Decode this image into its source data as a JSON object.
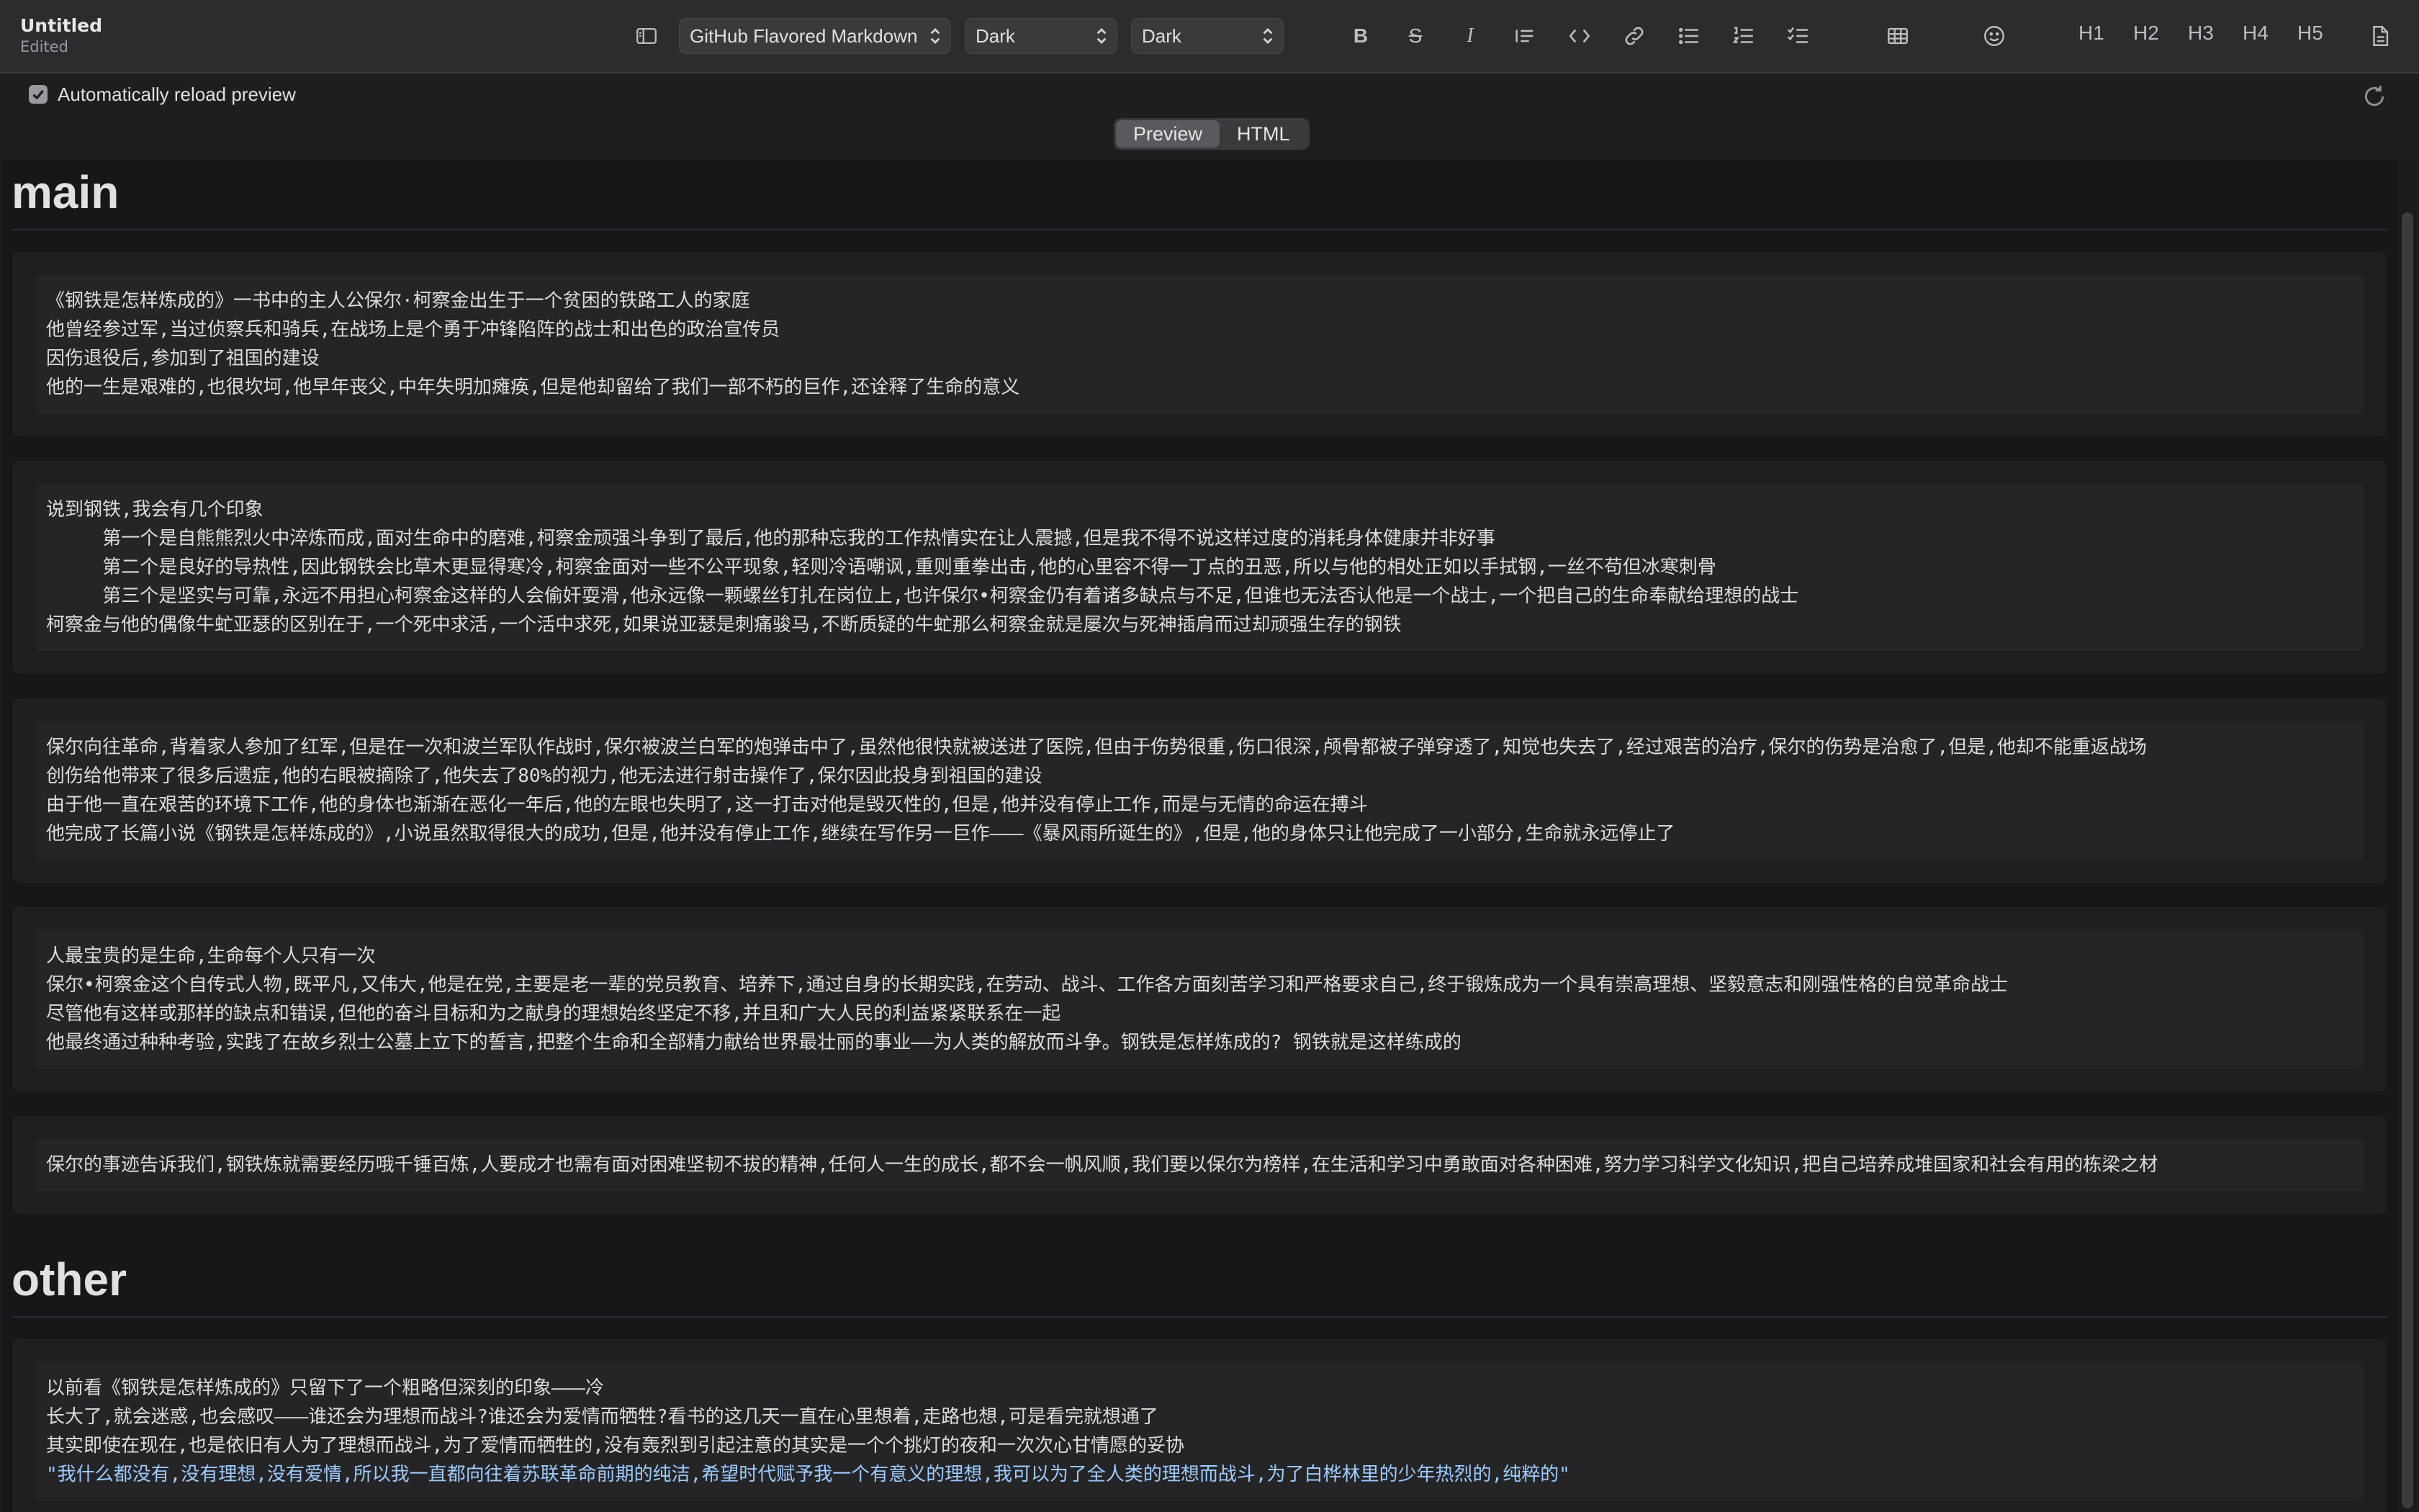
{
  "window": {
    "title": "Untitled",
    "subtitle": "Edited"
  },
  "toolbar": {
    "flavor_select": "GitHub Flavored Markdown",
    "theme_select_1": "Dark",
    "theme_select_2": "Dark",
    "headings": [
      "H1",
      "H2",
      "H3",
      "H4",
      "H5"
    ]
  },
  "options": {
    "auto_reload_label": "Automatically reload preview",
    "auto_reload_checked": true
  },
  "tabs": {
    "preview": "Preview",
    "html": "HTML",
    "active": "Preview"
  },
  "preview": {
    "sections": [
      {
        "heading": "main",
        "blocks": [
          [
            "《钢铁是怎样炼成的》一书中的主人公保尔·柯察金出生于一个贫困的铁路工人的家庭",
            "他曾经参过军,当过侦察兵和骑兵,在战场上是个勇于冲锋陷阵的战士和出色的政治宣传员",
            "因伤退役后,参加到了祖国的建设",
            "他的一生是艰难的,也很坎坷,他早年丧父,中年失明加瘫痪,但是他却留给了我们一部不朽的巨作,还诠释了生命的意义"
          ],
          [
            "说到钢铁,我会有几个印象",
            "     第一个是自熊熊烈火中淬炼而成,面对生命中的磨难,柯察金顽强斗争到了最后,他的那种忘我的工作热情实在让人震撼,但是我不得不说这样过度的消耗身体健康并非好事",
            "     第二个是良好的导热性,因此钢铁会比草木更显得寒冷,柯察金面对一些不公平现象,轻则冷语嘲讽,重则重拳出击,他的心里容不得一丁点的丑恶,所以与他的相处正如以手拭钢,一丝不苟但冰寒刺骨",
            "     第三个是坚实与可靠,永远不用担心柯察金这样的人会偷奸耍滑,他永远像一颗螺丝钉扎在岗位上,也许保尔•柯察金仍有着诸多缺点与不足,但谁也无法否认他是一个战士,一个把自己的生命奉献给理想的战士",
            "柯察金与他的偶像牛虻亚瑟的区别在于,一个死中求活,一个活中求死,如果说亚瑟是刺痛骏马,不断质疑的牛虻那么柯察金就是屡次与死神插肩而过却顽强生存的钢铁"
          ],
          [
            "保尔向往革命,背着家人参加了红军,但是在一次和波兰军队作战时,保尔被波兰白军的炮弹击中了,虽然他很快就被送进了医院,但由于伤势很重,伤口很深,颅骨都被子弹穿透了,知觉也失去了,经过艰苦的治疗,保尔的伤势是治愈了,但是,他却不能重返战场",
            "创伤给他带来了很多后遗症,他的右眼被摘除了,他失去了80%的视力,他无法进行射击操作了,保尔因此投身到祖国的建设",
            "由于他一直在艰苦的环境下工作,他的身体也渐渐在恶化一年后,他的左眼也失明了,这一打击对他是毁灭性的,但是,他并没有停止工作,而是与无情的命运在搏斗",
            "他完成了长篇小说《钢铁是怎样炼成的》,小说虽然取得很大的成功,但是,他并没有停止工作,继续在写作另一巨作———《暴风雨所诞生的》,但是,他的身体只让他完成了一小部分,生命就永远停止了"
          ],
          [
            "人最宝贵的是生命,生命每个人只有一次",
            "保尔•柯察金这个自传式人物,既平凡,又伟大,他是在党,主要是老一辈的党员教育、培养下,通过自身的长期实践,在劳动、战斗、工作各方面刻苦学习和严格要求自己,终于锻炼成为一个具有崇高理想、坚毅意志和刚强性格的自觉革命战士",
            "尽管他有这样或那样的缺点和错误,但他的奋斗目标和为之献身的理想始终坚定不移,并且和广大人民的利益紧紧联系在一起",
            "他最终通过种种考验,实践了在故乡烈士公墓上立下的誓言,把整个生命和全部精力献给世界最壮丽的事业——为人类的解放而斗争。钢铁是怎样炼成的? 钢铁就是这样练成的"
          ],
          [
            "保尔的事迹告诉我们,钢铁炼就需要经历哦千锤百炼,人要成才也需有面对困难坚韧不拔的精神,任何人一生的成长,都不会一帆风顺,我们要以保尔为榜样,在生活和学习中勇敢面对各种困难,努力学习科学文化知识,把自己培养成堆国家和社会有用的栋梁之材"
          ]
        ]
      },
      {
        "heading": "other",
        "blocks": [
          [
            "以前看《钢铁是怎样炼成的》只留下了一个粗略但深刻的印象———冷",
            "长大了,就会迷惑,也会感叹———谁还会为理想而战斗?谁还会为爱情而牺牲?看书的这几天一直在心里想着,走路也想,可是看完就想通了",
            "其实即使在现在,也是依旧有人为了理想而战斗,为了爱情而牺牲的,没有轰烈到引起注意的其实是一个个挑灯的夜和一次次心甘情愿的妥协",
            "\"我什么都没有,没有理想,没有爱情,所以我一直都向往着苏联革命前期的纯洁,希望时代赋予我一个有意义的理想,我可以为了全人类的理想而战斗,为了白桦林里的少年热烈的,纯粹的\""
          ]
        ]
      }
    ]
  }
}
